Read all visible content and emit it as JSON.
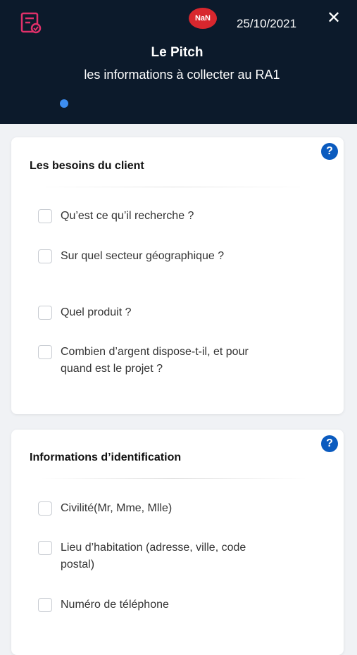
{
  "header": {
    "avatar_text": "NaN",
    "date": "25/10/2021",
    "close_symbol": "✕",
    "title": "Le Pitch",
    "subtitle": "les informations à collecter au RA1"
  },
  "sections": [
    {
      "title": "Les besoins du client",
      "help_symbol": "?",
      "items": [
        "Qu’est ce qu’il recherche ?",
        "Sur quel secteur géographique ?",
        "Quel produit ?",
        "Combien d’argent dispose-t-il, et pour quand est le projet ?"
      ]
    },
    {
      "title": "Informations d’identification",
      "help_symbol": "?",
      "items": [
        "Civilité(Mr, Mme, Mlle)",
        "Lieu d’habitation (adresse, ville, code postal)",
        "Numéro de téléphone"
      ]
    }
  ],
  "colors": {
    "header_bg": "#0c1a2b",
    "accent_pink": "#e0306a",
    "avatar_red": "#d8272e",
    "dot_blue": "#3d8df0",
    "help_blue": "#0b5bbf"
  }
}
